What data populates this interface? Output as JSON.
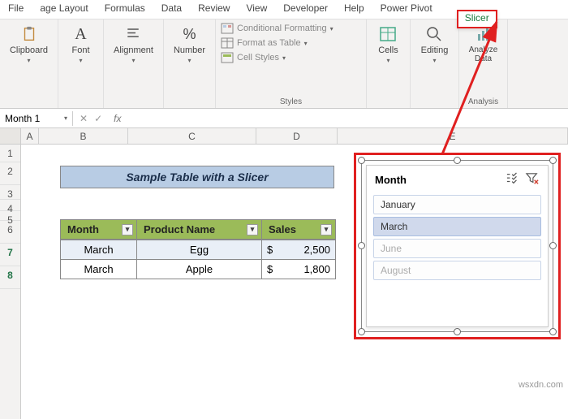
{
  "tabs": [
    "File",
    "age Layout",
    "Formulas",
    "Data",
    "Review",
    "View",
    "Developer",
    "Help",
    "Power Pivot",
    "Slicer"
  ],
  "ribbon": {
    "clipboard": "Clipboard",
    "font": "Font",
    "alignment": "Alignment",
    "number": "Number",
    "styles": "Styles",
    "cond_fmt": "Conditional Formatting",
    "fmt_table": "Format as Table",
    "cell_styles": "Cell Styles",
    "cells": "Cells",
    "editing": "Editing",
    "analyze": "Analyze Data",
    "analysis": "Analysis"
  },
  "name_box": "Month 1",
  "fx": "fx",
  "columns": [
    "A",
    "B",
    "C",
    "D",
    "E"
  ],
  "rows": [
    "1",
    "2",
    "3",
    "4",
    "5",
    "6",
    "7",
    "8"
  ],
  "title": "Sample Table with a Slicer",
  "table": {
    "headers": [
      "Month",
      "Product Name",
      "Sales"
    ],
    "rows": [
      {
        "month": "March",
        "product": "Egg",
        "price": "2,500",
        "cur": "$"
      },
      {
        "month": "March",
        "product": "Apple",
        "price": "1,800",
        "cur": "$"
      }
    ]
  },
  "slicer": {
    "title": "Month",
    "items": [
      "January",
      "March",
      "June",
      "August"
    ]
  },
  "watermark": "wsxdn.com"
}
